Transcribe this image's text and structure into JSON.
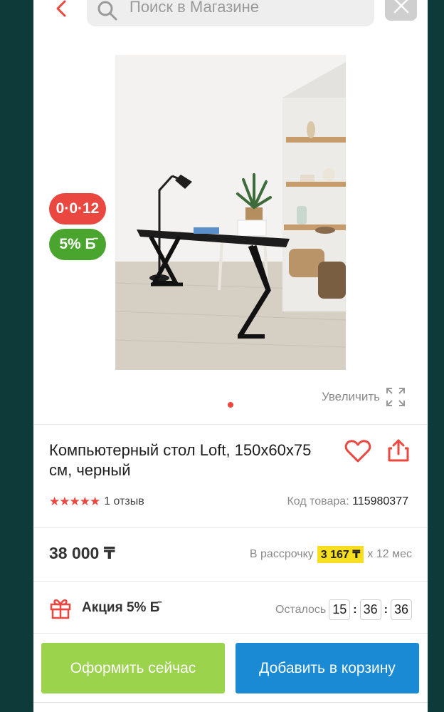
{
  "header": {
    "search_placeholder": "Поиск в Магазине"
  },
  "product": {
    "badge_installment": "0·0·12",
    "badge_bonus": "5% Б̄",
    "zoom_label": "Увеличить",
    "title": "Компьютерный стол Loft, 150x60x75 см, черный",
    "stars": "★★★★★",
    "reviews": "1 отзыв",
    "sku_label": "Код товара:",
    "sku_value": "115980377",
    "price": "38 000 ₸",
    "installment_prefix": "В рассрочку",
    "installment_amount": "3 167 ₸",
    "installment_suffix": "x 12 мес",
    "promo_label": "Акция 5% Б̄",
    "timer_label": "Осталось",
    "timer_h": "15",
    "timer_m": "36",
    "timer_s": "36",
    "rating": 5
  },
  "actions": {
    "checkout": "Оформить сейчас",
    "add_to_cart": "Добавить в корзину"
  },
  "colors": {
    "accent_red": "#e9473f",
    "green": "#4aa52e",
    "button_green": "#9bd34c",
    "button_blue": "#1a8ad4",
    "highlight_yellow": "#f7df1f"
  },
  "icons": [
    "chevron-left-icon",
    "search-icon",
    "close-icon",
    "expand-icon",
    "heart-icon",
    "share-icon",
    "gift-icon"
  ]
}
